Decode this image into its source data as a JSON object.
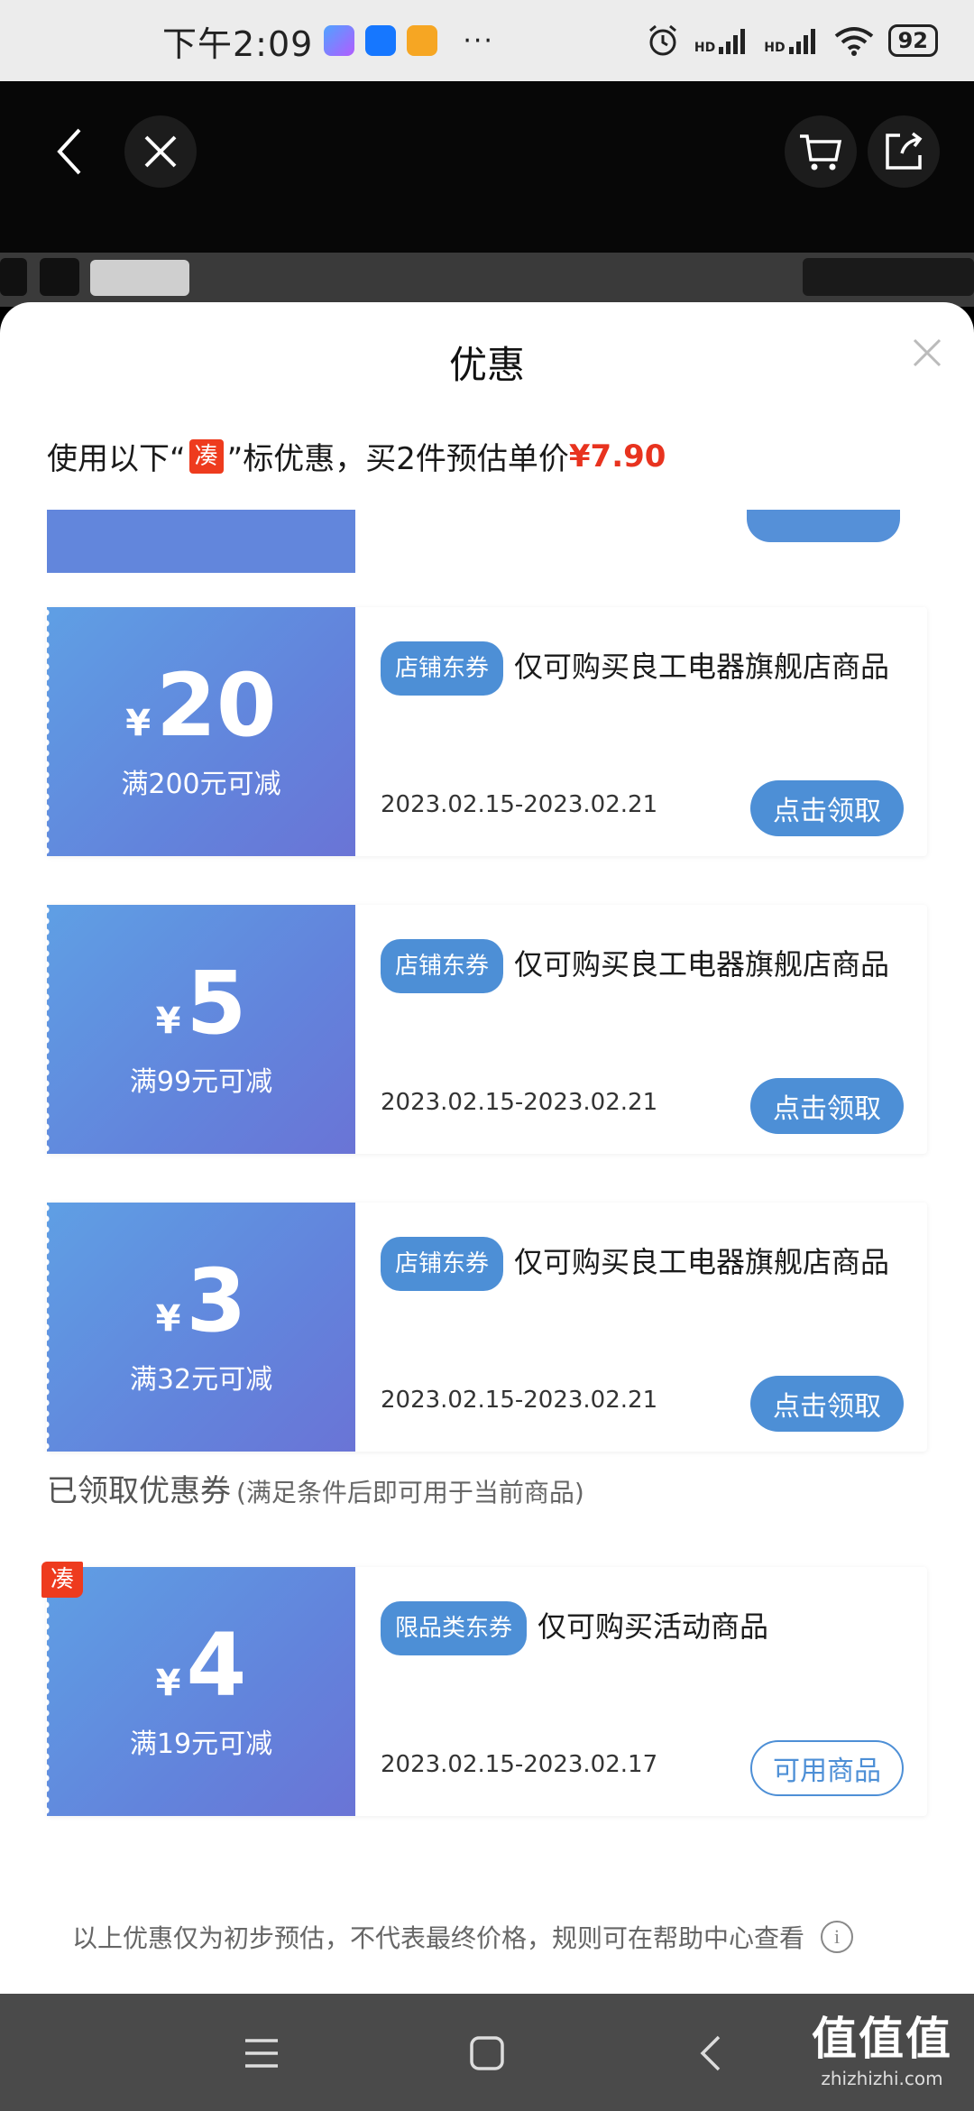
{
  "status_bar": {
    "time": "下午2:09",
    "dots": "···",
    "signal_label": "HD",
    "battery": "92"
  },
  "sheet": {
    "title": "优惠",
    "summary_prefix": "使用以下“",
    "summary_badge": "凑",
    "summary_middle": "”标优惠，买2件预估单价",
    "summary_price": "¥7.90"
  },
  "coupons": [
    {
      "yen": "¥",
      "amount": "20",
      "condition": "满200元可减",
      "tag": "店铺东券",
      "description": "仅可购买良工电器旗舰店商品",
      "date": "2023.02.15-2023.02.21",
      "button": "点击领取"
    },
    {
      "yen": "¥",
      "amount": "5",
      "condition": "满99元可减",
      "tag": "店铺东券",
      "description": "仅可购买良工电器旗舰店商品",
      "date": "2023.02.15-2023.02.21",
      "button": "点击领取"
    },
    {
      "yen": "¥",
      "amount": "3",
      "condition": "满32元可减",
      "tag": "店铺东券",
      "description": "仅可购买良工电器旗舰店商品",
      "date": "2023.02.15-2023.02.21",
      "button": "点击领取"
    }
  ],
  "claimed_section": {
    "title": "已领取优惠券",
    "subtitle": "(满足条件后即可用于当前商品)"
  },
  "claimed_coupons": [
    {
      "badge": "凑",
      "yen": "¥",
      "amount": "4",
      "condition": "满19元可减",
      "tag": "限品类东券",
      "description": "仅可购买活动商品",
      "date": "2023.02.15-2023.02.17",
      "button": "可用商品"
    }
  ],
  "footnote": "以上优惠仅为初步预估，不代表最终价格，规则可在帮助中心查看",
  "info_icon_glyph": "i",
  "watermark": {
    "main": "值值值",
    "sub": "zhizhizhi.com"
  },
  "colors": {
    "accent_blue": "#4d8fd6",
    "price_red": "#e8331f",
    "badge_red": "#ee3b1e"
  },
  "icons": [
    "back-icon",
    "close-icon",
    "cart-icon",
    "share-icon",
    "menu-icon",
    "home-icon",
    "nav-back-icon",
    "info-icon"
  ]
}
